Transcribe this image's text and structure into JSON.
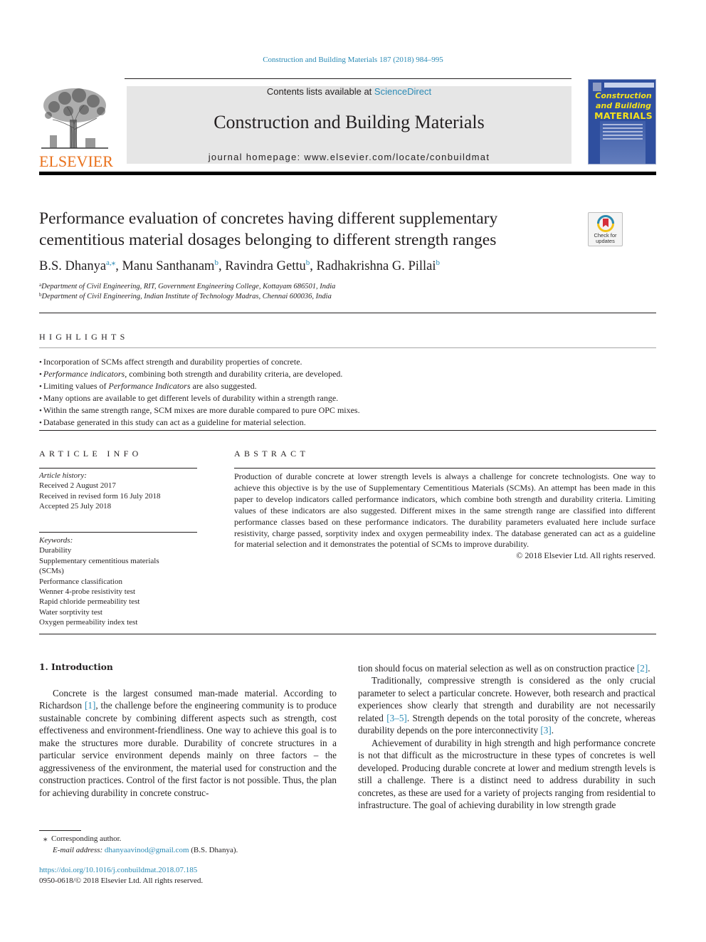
{
  "running_head": "Construction and Building Materials 187 (2018) 984–995",
  "masthead": {
    "contents_prefix": "Contents lists available at ",
    "contents_link": "ScienceDirect",
    "journal_name": "Construction and Building Materials",
    "homepage": "journal homepage: www.elsevier.com/locate/conbuildmat"
  },
  "publisher_logo_text": "ELSEVIER",
  "cover": {
    "line1": "Construction",
    "line2": "and Building",
    "line3": "MATERIALS"
  },
  "crossmark": {
    "line1": "Check for",
    "line2": "updates"
  },
  "article": {
    "title_line1": "Performance evaluation of concretes having different supplementary",
    "title_line2": "cementitious material dosages belonging to different strength ranges",
    "authors": [
      {
        "name": "B.S. Dhanya",
        "sup": "a,⁎",
        "sep": ", "
      },
      {
        "name": "Manu Santhanam",
        "sup": "b",
        "sep": ", "
      },
      {
        "name": "Ravindra Gettu",
        "sup": "b",
        "sep": ", "
      },
      {
        "name": "Radhakrishna G. Pillai",
        "sup": "b",
        "sep": ""
      }
    ],
    "affiliations": [
      {
        "sup": "a",
        "text": "Department of Civil Engineering, RIT, Government Engineering College, Kottayam 686501, India"
      },
      {
        "sup": "b",
        "text": "Department of Civil Engineering, Indian Institute of Technology Madras, Chennai 600036, India"
      }
    ]
  },
  "highlights": {
    "heading": "HIGHLIGHTS",
    "items": [
      {
        "pre": "Incorporation of SCMs affect strength and durability properties of concrete.",
        "ital": "",
        "post": ""
      },
      {
        "pre": "",
        "ital": "Performance indicators",
        "post": ", combining both strength and durability criteria, are developed."
      },
      {
        "pre": "Limiting values of ",
        "ital": "Performance Indicators",
        "post": " are also suggested."
      },
      {
        "pre": "Many options are available to get different levels of durability within a strength range.",
        "ital": "",
        "post": ""
      },
      {
        "pre": "Within the same strength range, SCM mixes are more durable compared to pure OPC mixes.",
        "ital": "",
        "post": ""
      },
      {
        "pre": "Database generated in this study can act as a guideline for material selection.",
        "ital": "",
        "post": ""
      }
    ]
  },
  "article_info": {
    "heading": "ARTICLE INFO",
    "history_label": "Article history:",
    "history": [
      "Received 2 August 2017",
      "Received in revised form 16 July 2018",
      "Accepted 25 July 2018"
    ],
    "keywords_label": "Keywords:",
    "keywords": [
      "Durability",
      "Supplementary cementitious materials",
      "(SCMs)",
      "Performance classification",
      "Wenner 4-probe resistivity test",
      "Rapid chloride permeability test",
      "Water sorptivity test",
      "Oxygen permeability index test"
    ]
  },
  "abstract": {
    "heading": "ABSTRACT",
    "text": "Production of durable concrete at lower strength levels is always a challenge for concrete technologists. One way to achieve this objective is by the use of Supplementary Cementitious Materials (SCMs). An attempt has been made in this paper to develop indicators called performance indicators, which combine both strength and durability criteria. Limiting values of these indicators are also suggested. Different mixes in the same strength range are classified into different performance classes based on these performance indicators. The durability parameters evaluated here include surface resistivity, charge passed, sorptivity index and oxygen permeability index. The database generated can act as a guideline for material selection and it demonstrates the potential of SCMs to improve durability.",
    "copyright": "© 2018 Elsevier Ltd. All rights reserved."
  },
  "introduction": {
    "heading": "1. Introduction",
    "p1_a": "Concrete is the largest consumed man-made material. According to Richardson ",
    "p1_ref": "[1]",
    "p1_b": ", the challenge before the engineering community is to produce sustainable concrete by combining different aspects such as strength, cost effectiveness and environment-friendliness. One way to achieve this goal is to make the structures more durable. Durability of concrete structures in a particular service environment depends mainly on three factors – the aggressiveness of the environment, the material used for construction and the construction practices. Control of the first factor is not possible. Thus, the plan for achieving durability in concrete construc-",
    "p1_c": "tion should focus on material selection as well as on construction practice ",
    "p1_ref2": "[2]",
    "p2_a": "Traditionally, compressive strength is considered as the only crucial parameter to select a particular concrete. However, both research and practical experiences show clearly that strength and durability are not necessarily related ",
    "p2_ref": "[3–5]",
    "p2_b": ". Strength depends on the total porosity of the concrete, whereas durability depends on the pore interconnectivity ",
    "p2_ref2": "[3]",
    "p3": "Achievement of durability in high strength and high performance concrete is not that difficult as the microstructure in these types of concretes is well developed. Producing durable concrete at lower and medium strength levels is still a challenge. There is a distinct need to address durability in such concretes, as these are used for a variety of projects ranging from residential to infrastructure. The goal of achieving durability in low strength grade"
  },
  "footnote": {
    "star": "⁎",
    "corresponding": "Corresponding author.",
    "email_label": "E-mail address:",
    "email": "dhanyaavinod@gmail.com",
    "email_owner": "(B.S. Dhanya)."
  },
  "doi": "https://doi.org/10.1016/j.conbuildmat.2018.07.185",
  "issn_line": "0950-0618/© 2018 Elsevier Ltd. All rights reserved."
}
